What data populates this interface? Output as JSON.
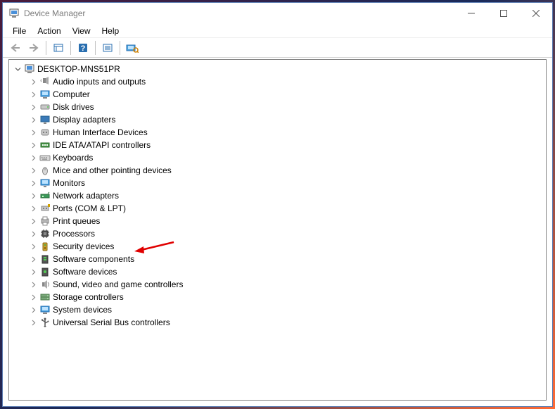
{
  "window": {
    "title": "Device Manager"
  },
  "menubar": {
    "file": "File",
    "action": "Action",
    "view": "View",
    "help": "Help"
  },
  "tree": {
    "root_label": "DESKTOP-MNS51PR",
    "categories": [
      {
        "label": "Audio inputs and outputs",
        "icon": "audio"
      },
      {
        "label": "Computer",
        "icon": "computer"
      },
      {
        "label": "Disk drives",
        "icon": "disk"
      },
      {
        "label": "Display adapters",
        "icon": "display"
      },
      {
        "label": "Human Interface Devices",
        "icon": "hid"
      },
      {
        "label": "IDE ATA/ATAPI controllers",
        "icon": "ide"
      },
      {
        "label": "Keyboards",
        "icon": "keyboard"
      },
      {
        "label": "Mice and other pointing devices",
        "icon": "mouse"
      },
      {
        "label": "Monitors",
        "icon": "monitor"
      },
      {
        "label": "Network adapters",
        "icon": "network"
      },
      {
        "label": "Ports (COM & LPT)",
        "icon": "ports"
      },
      {
        "label": "Print queues",
        "icon": "print"
      },
      {
        "label": "Processors",
        "icon": "processor"
      },
      {
        "label": "Security devices",
        "icon": "security",
        "highlighted": true
      },
      {
        "label": "Software components",
        "icon": "softcomp"
      },
      {
        "label": "Software devices",
        "icon": "softdev"
      },
      {
        "label": "Sound, video and game controllers",
        "icon": "sound"
      },
      {
        "label": "Storage controllers",
        "icon": "storage"
      },
      {
        "label": "System devices",
        "icon": "system"
      },
      {
        "label": "Universal Serial Bus controllers",
        "icon": "usb"
      }
    ]
  }
}
